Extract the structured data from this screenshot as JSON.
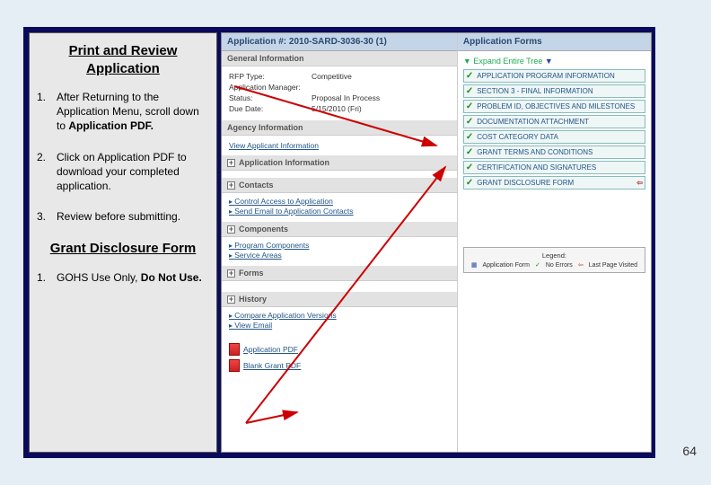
{
  "page_number": "64",
  "instructions": {
    "title": "Print and Review Application",
    "steps": [
      {
        "num": "1.",
        "text_a": "After Returning to the Application Menu, scroll down to ",
        "bold": "Application PDF."
      },
      {
        "num": "2.",
        "text_a": "Click on Application PDF to download your completed application."
      },
      {
        "num": "3.",
        "text_a": "Review before submitting."
      }
    ],
    "subheading": "Grant Disclosure Form",
    "sub_steps": [
      {
        "num": "1.",
        "text_a": "GOHS Use Only, ",
        "bold": "Do Not Use."
      }
    ]
  },
  "app": {
    "header": "Application #: 2010-SARD-3036-30 (1)",
    "sections": {
      "general": "General Information",
      "agency": "Agency Information",
      "app_info": "Application Information",
      "contacts": "Contacts",
      "components": "Components",
      "forms_hdr": "Forms",
      "history": "History"
    },
    "info": {
      "rfp_label": "RFP Type:",
      "rfp_val": "Competitive",
      "mgr_label": "Application Manager:",
      "status_label": "Status:",
      "status_val": "Proposal In Process",
      "due_label": "Due Date:",
      "due_val": "5/15/2010 (Fri)"
    },
    "agency_link": "View Applicant Information",
    "contacts_links": [
      "Control Access to Application",
      "Send Email to Application Contacts"
    ],
    "components_links": [
      "Program Components",
      "Service Areas"
    ],
    "history_links": [
      "Compare Application Versions",
      "View Email"
    ],
    "pdf_items": [
      "Application PDF",
      "Blank Grant PDF"
    ]
  },
  "forms": {
    "header": "Application Forms",
    "tree_label": "Expand Entire Tree",
    "items": [
      {
        "label": "APPLICATION PROGRAM INFORMATION",
        "check": true
      },
      {
        "label": "SECTION 3 - FINAL INFORMATION",
        "check": true
      },
      {
        "label": "PROBLEM ID, OBJECTIVES AND MILESTONES",
        "check": true
      },
      {
        "label": "DOCUMENTATION ATTACHMENT",
        "check": true
      },
      {
        "label": "COST CATEGORY DATA",
        "check": true
      },
      {
        "label": "GRANT TERMS AND CONDITIONS",
        "check": true
      },
      {
        "label": "CERTIFICATION AND SIGNATURES",
        "check": true
      },
      {
        "label": "GRANT DISCLOSURE FORM",
        "check": true,
        "back": true
      }
    ],
    "legend_title": "Legend:",
    "legend_items": [
      "Application Form",
      "No Errors",
      "Last Page Visited"
    ]
  }
}
